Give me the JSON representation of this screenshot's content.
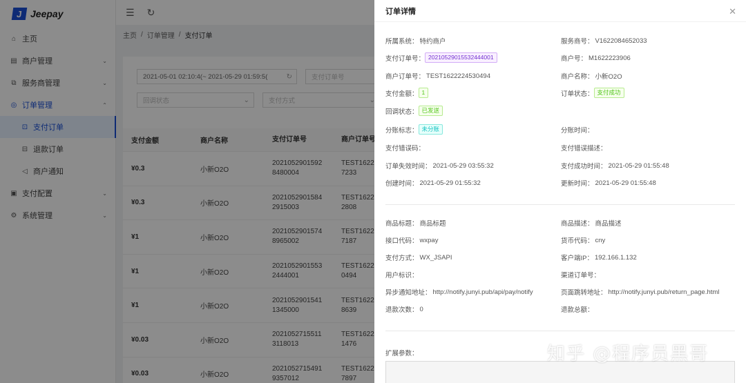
{
  "app": {
    "logo_letter": "J",
    "logo_text": "Jeepay"
  },
  "sidebar": {
    "items": [
      {
        "label": "主页",
        "icon": "home-icon"
      },
      {
        "label": "商户管理",
        "icon": "merchant-icon",
        "arrow": "down"
      },
      {
        "label": "服务商管理",
        "icon": "provider-icon",
        "arrow": "down"
      },
      {
        "label": "订单管理",
        "icon": "order-icon",
        "arrow": "up"
      },
      {
        "label": "支付订单",
        "icon": "pay-order-icon",
        "sub": true,
        "active": true
      },
      {
        "label": "退款订单",
        "icon": "refund-icon",
        "sub": true
      },
      {
        "label": "商户通知",
        "icon": "notify-icon",
        "sub": true
      },
      {
        "label": "支付配置",
        "icon": "pay-config-icon",
        "arrow": "down"
      },
      {
        "label": "系统管理",
        "icon": "settings-icon",
        "arrow": "down"
      }
    ]
  },
  "topbar": {
    "menu_icon": "☰",
    "refresh_icon": "↻"
  },
  "breadcrumb": {
    "home": "主页",
    "sep": "/",
    "section": "订单管理",
    "current": "支付订单"
  },
  "filters": {
    "date_range": "2021-05-01 02:10:4(~ 2021-05-29 01:59:5(",
    "order_no_placeholder": "支付订单号",
    "callback_status_placeholder": "回调状态",
    "pay_method_placeholder": "支付方式"
  },
  "table": {
    "headers": [
      "支付金额",
      "商户名称",
      "支付订单号",
      "商户订单号"
    ],
    "rows": [
      {
        "amount": "¥0.3",
        "merchant": "小新O2O",
        "order_no_1": "2021052901592",
        "order_no_2": "8480004",
        "mch_no_1": "TEST1622",
        "mch_no_2": "7233"
      },
      {
        "amount": "¥0.3",
        "merchant": "小新O2O",
        "order_no_1": "2021052901584",
        "order_no_2": "2915003",
        "mch_no_1": "TEST1622",
        "mch_no_2": "2808"
      },
      {
        "amount": "¥1",
        "merchant": "小新O2O",
        "order_no_1": "2021052901574",
        "order_no_2": "8965002",
        "mch_no_1": "TEST1622",
        "mch_no_2": "7187"
      },
      {
        "amount": "¥1",
        "merchant": "小新O2O",
        "order_no_1": "2021052901553",
        "order_no_2": "2444001",
        "mch_no_1": "TEST1622",
        "mch_no_2": "0494"
      },
      {
        "amount": "¥1",
        "merchant": "小新O2O",
        "order_no_1": "2021052901541",
        "order_no_2": "1345000",
        "mch_no_1": "TEST1622",
        "mch_no_2": "8639"
      },
      {
        "amount": "¥0.03",
        "merchant": "小新O2O",
        "order_no_1": "2021052715511",
        "order_no_2": "3118013",
        "mch_no_1": "TEST1622",
        "mch_no_2": "1476"
      },
      {
        "amount": "¥0.03",
        "merchant": "小新O2O",
        "order_no_1": "2021052715491",
        "order_no_2": "9357012",
        "mch_no_1": "TEST1622",
        "mch_no_2": "7897"
      }
    ]
  },
  "drawer": {
    "title": "订单详情",
    "close_icon": "✕",
    "fields": {
      "system": {
        "label": "所属系统：",
        "value": "特约商户"
      },
      "provider_no": {
        "label": "服务商号：",
        "value": "V1622084652033"
      },
      "pay_order_no": {
        "label": "支付订单号：",
        "value": "20210529015532444001"
      },
      "mch_no": {
        "label": "商户号：",
        "value": "M1622223906"
      },
      "mch_order_no": {
        "label": "商户订单号：",
        "value": "TEST1622224530494"
      },
      "mch_name": {
        "label": "商户名称：",
        "value": "小新O2O"
      },
      "amount": {
        "label": "支付金额：",
        "value": "1"
      },
      "order_state": {
        "label": "订单状态：",
        "value": "支付成功"
      },
      "notify_state": {
        "label": "回调状态：",
        "value": "已发送"
      },
      "div_state": {
        "label": "分账标志：",
        "value": "未分账"
      },
      "div_time": {
        "label": "分账时间：",
        "value": ""
      },
      "err_code": {
        "label": "支付错误码：",
        "value": ""
      },
      "err_msg": {
        "label": "支付错误描述：",
        "value": ""
      },
      "expire_time": {
        "label": "订单失效时间：",
        "value": "2021-05-29 03:55:32"
      },
      "success_time": {
        "label": "支付成功时间：",
        "value": "2021-05-29 01:55:48"
      },
      "created_at": {
        "label": "创建时间：",
        "value": "2021-05-29 01:55:32"
      },
      "updated_at": {
        "label": "更新时间：",
        "value": "2021-05-29 01:55:48"
      },
      "subject": {
        "label": "商品标题：",
        "value": "商品标题"
      },
      "body": {
        "label": "商品描述：",
        "value": "商品描述"
      },
      "if_code": {
        "label": "接口代码：",
        "value": "wxpay"
      },
      "currency": {
        "label": "货币代码：",
        "value": "cny"
      },
      "way_code": {
        "label": "支付方式：",
        "value": "WX_JSAPI"
      },
      "client_ip": {
        "label": "客户端IP：",
        "value": "192.166.1.132"
      },
      "user_id": {
        "label": "用户标识：",
        "value": ""
      },
      "channel_order_no": {
        "label": "渠道订单号：",
        "value": ""
      },
      "notify_url": {
        "label": "异步通知地址：",
        "value": "http://notify.junyi.pub/api/pay/notify"
      },
      "return_url": {
        "label": "页面跳转地址：",
        "value": "http://notify.junyi.pub/return_page.html"
      },
      "refund_times": {
        "label": "退款次数：",
        "value": "0"
      },
      "refund_amount": {
        "label": "退款总额：",
        "value": ""
      },
      "ext_param": {
        "label": "扩展参数：",
        "value": ""
      }
    }
  },
  "watermark": "知乎 @程序员黑哥",
  "colors": {
    "primary": "#1a4fd6",
    "success": "#52c41a",
    "purple": "#722ed1",
    "cyan": "#13c2c2"
  }
}
